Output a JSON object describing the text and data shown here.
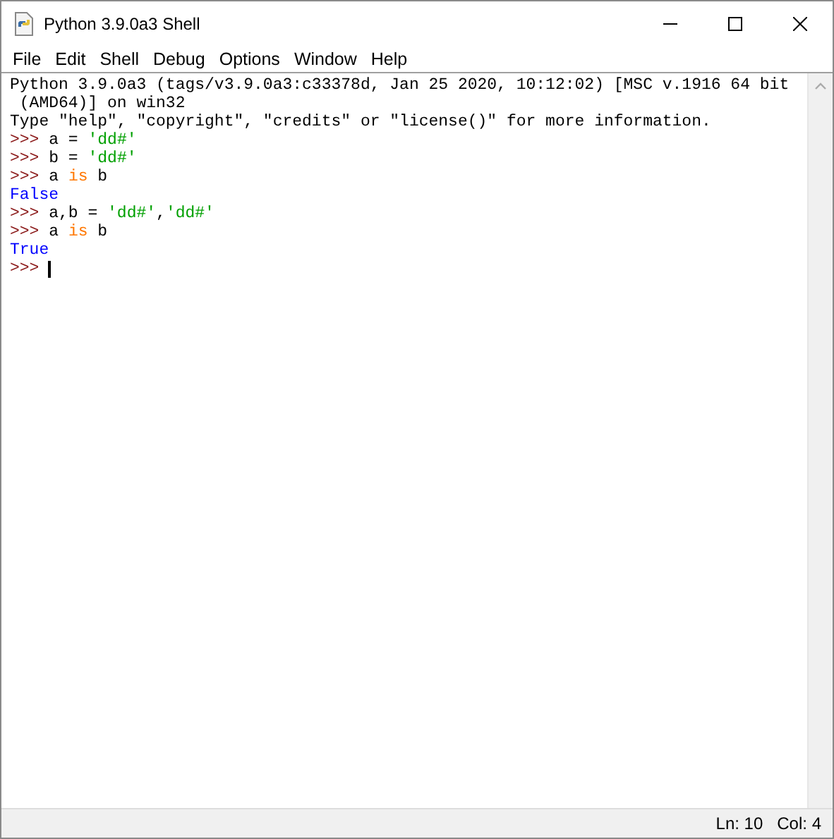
{
  "window": {
    "title": "Python 3.9.0a3 Shell"
  },
  "menu": [
    "File",
    "Edit",
    "Shell",
    "Debug",
    "Options",
    "Window",
    "Help"
  ],
  "shell_lines": [
    [
      {
        "kind": "output",
        "text": "Python 3.9.0a3 (tags/v3.9.0a3:c33378d, Jan 25 2020, 10:12:02) [MSC v.1916 64 bit"
      }
    ],
    [
      {
        "kind": "output",
        "text": " (AMD64)] on win32"
      }
    ],
    [
      {
        "kind": "output",
        "text": "Type \"help\", \"copyright\", \"credits\" or \"license()\" for more information."
      }
    ],
    [
      {
        "kind": "prompt",
        "text": ">>>"
      },
      {
        "kind": "code",
        "text": " a = "
      },
      {
        "kind": "string",
        "text": "'dd#'"
      }
    ],
    [
      {
        "kind": "prompt",
        "text": ">>>"
      },
      {
        "kind": "code",
        "text": " b = "
      },
      {
        "kind": "string",
        "text": "'dd#'"
      }
    ],
    [
      {
        "kind": "prompt",
        "text": ">>>"
      },
      {
        "kind": "code",
        "text": " a "
      },
      {
        "kind": "keyword",
        "text": "is"
      },
      {
        "kind": "code",
        "text": " b"
      }
    ],
    [
      {
        "kind": "result",
        "text": "False"
      }
    ],
    [
      {
        "kind": "prompt",
        "text": ">>>"
      },
      {
        "kind": "code",
        "text": " a,b = "
      },
      {
        "kind": "string",
        "text": "'dd#'"
      },
      {
        "kind": "code",
        "text": ","
      },
      {
        "kind": "string",
        "text": "'dd#'"
      }
    ],
    [
      {
        "kind": "prompt",
        "text": ">>>"
      },
      {
        "kind": "code",
        "text": " a "
      },
      {
        "kind": "keyword",
        "text": "is"
      },
      {
        "kind": "code",
        "text": " b"
      }
    ],
    [
      {
        "kind": "result",
        "text": "True"
      }
    ],
    [
      {
        "kind": "prompt",
        "text": ">>>"
      },
      {
        "kind": "cursor"
      }
    ]
  ],
  "status_bar": {
    "line": "Ln: 10",
    "column": "Col: 4"
  }
}
